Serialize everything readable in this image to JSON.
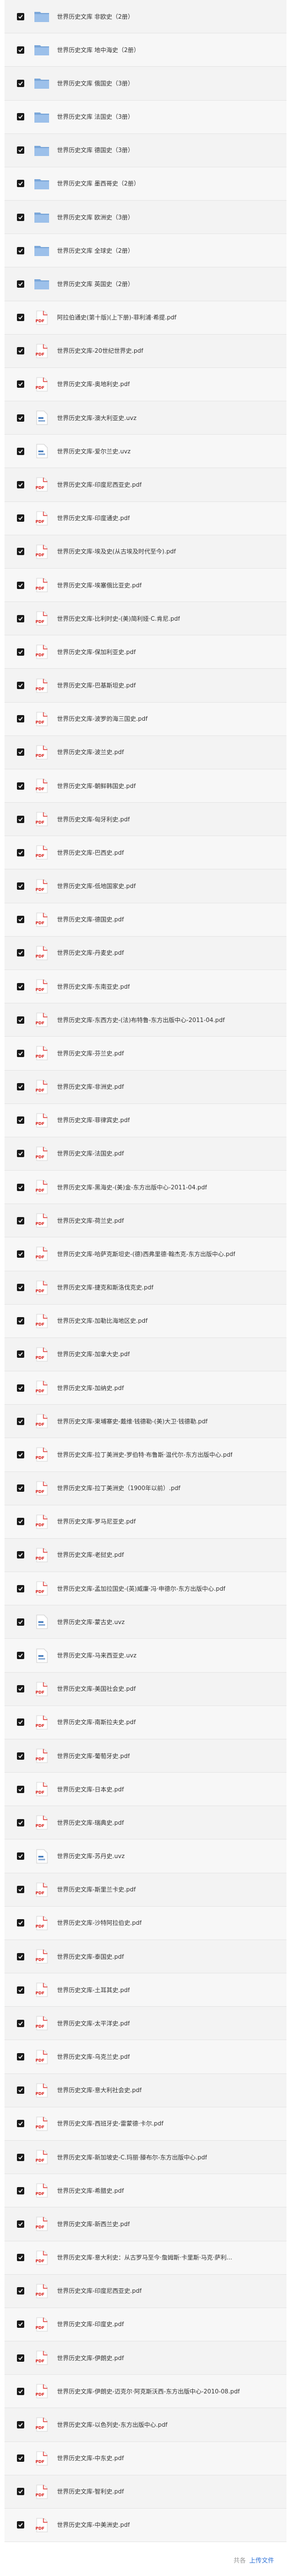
{
  "files": [
    {
      "name": "世界历史文库 非欧史（2册）",
      "icon": "folder-icon",
      "type": "folder"
    },
    {
      "name": "世界历史文库 地中海史（2册）",
      "icon": "folder-icon",
      "type": "folder"
    },
    {
      "name": "世界历史文库 俄国史（3册）",
      "icon": "folder-icon",
      "type": "folder"
    },
    {
      "name": "世界历史文库 法国史（3册）",
      "icon": "folder-icon",
      "type": "folder"
    },
    {
      "name": "世界历史文库 德国史（3册）",
      "icon": "folder-icon",
      "type": "folder"
    },
    {
      "name": "世界历史文库 墨西哥史（2册）",
      "icon": "folder-icon",
      "type": "folder"
    },
    {
      "name": "世界历史文库 欧洲史（3册）",
      "icon": "folder-icon",
      "type": "folder"
    },
    {
      "name": "世界历史文库 全球史（2册）",
      "icon": "folder-icon",
      "type": "folder"
    },
    {
      "name": "世界历史文库 英国史（2册）",
      "icon": "folder-icon",
      "type": "folder"
    },
    {
      "name": "阿拉伯通史(第十版)(上下册)-菲利浦·希提.pdf",
      "icon": "pdf-icon",
      "type": "pdf"
    },
    {
      "name": "世界历史文库-20世纪世界史.pdf",
      "icon": "pdf-icon",
      "type": "pdf"
    },
    {
      "name": "世界历史文库-奥地利史.pdf",
      "icon": "pdf-icon",
      "type": "pdf"
    },
    {
      "name": "世界历史文库-澳大利亚史.uvz",
      "icon": "uvz-icon",
      "type": "uvz"
    },
    {
      "name": "世界历史文库-爱尔兰史.uvz",
      "icon": "uvz-icon",
      "type": "uvz"
    },
    {
      "name": "世界历史文库-印度尼西亚史.pdf",
      "icon": "pdf-icon",
      "type": "pdf"
    },
    {
      "name": "世界历史文库-印度通史.pdf",
      "icon": "pdf-icon",
      "type": "pdf"
    },
    {
      "name": "世界历史文库-埃及史(从古埃及时代至今).pdf",
      "icon": "pdf-icon",
      "type": "pdf"
    },
    {
      "name": "世界历史文库-埃塞俄比亚史.pdf",
      "icon": "pdf-icon",
      "type": "pdf"
    },
    {
      "name": "世界历史文库-比利时史-(美)简利娅·C.肯尼.pdf",
      "icon": "pdf-icon",
      "type": "pdf"
    },
    {
      "name": "世界历史文库-保加利亚史.pdf",
      "icon": "pdf-icon",
      "type": "pdf"
    },
    {
      "name": "世界历史文库-巴基斯坦史.pdf",
      "icon": "pdf-icon",
      "type": "pdf"
    },
    {
      "name": "世界历史文库-波罗的海三国史.pdf",
      "icon": "pdf-icon",
      "type": "pdf"
    },
    {
      "name": "世界历史文库-波兰史.pdf",
      "icon": "pdf-icon",
      "type": "pdf"
    },
    {
      "name": "世界历史文库-朝鲜韩国史.pdf",
      "icon": "pdf-icon",
      "type": "pdf"
    },
    {
      "name": "世界历史文库-匈牙利史.pdf",
      "icon": "pdf-icon",
      "type": "pdf"
    },
    {
      "name": "世界历史文库-巴西史.pdf",
      "icon": "pdf-icon",
      "type": "pdf"
    },
    {
      "name": "世界历史文库-低地国家史.pdf",
      "icon": "pdf-icon",
      "type": "pdf"
    },
    {
      "name": "世界历史文库-德国史.pdf",
      "icon": "pdf-icon",
      "type": "pdf"
    },
    {
      "name": "世界历史文库-丹麦史.pdf",
      "icon": "pdf-icon",
      "type": "pdf"
    },
    {
      "name": "世界历史文库-东南亚史.pdf",
      "icon": "pdf-icon",
      "type": "pdf"
    },
    {
      "name": "世界历史文库-东西方史-(法)布特鲁-东方出版中心-2011-04.pdf",
      "icon": "pdf-icon",
      "type": "pdf"
    },
    {
      "name": "世界历史文库-芬兰史.pdf",
      "icon": "pdf-icon",
      "type": "pdf"
    },
    {
      "name": "世界历史文库-非洲史.pdf",
      "icon": "pdf-icon",
      "type": "pdf"
    },
    {
      "name": "世界历史文库-菲律宾史.pdf",
      "icon": "pdf-icon",
      "type": "pdf"
    },
    {
      "name": "世界历史文库-法国史.pdf",
      "icon": "pdf-icon",
      "type": "pdf"
    },
    {
      "name": "世界历史文库-黑海史-(美)金-东方出版中心-2011-04.pdf",
      "icon": "pdf-icon",
      "type": "pdf"
    },
    {
      "name": "世界历史文库-荷兰史.pdf",
      "icon": "pdf-icon",
      "type": "pdf"
    },
    {
      "name": "世界历史文库-哈萨克斯坦史-(德)西弗里德·翰杰克-东方出版中心.pdf",
      "icon": "pdf-icon",
      "type": "pdf"
    },
    {
      "name": "世界历史文库-捷克和斯洛伐克史.pdf",
      "icon": "pdf-icon",
      "type": "pdf"
    },
    {
      "name": "世界历史文库-加勒比海地区史.pdf",
      "icon": "pdf-icon",
      "type": "pdf"
    },
    {
      "name": "世界历史文库-加拿大史.pdf",
      "icon": "pdf-icon",
      "type": "pdf"
    },
    {
      "name": "世界历史文库-加纳史.pdf",
      "icon": "pdf-icon",
      "type": "pdf"
    },
    {
      "name": "世界历史文库-柬埔寨史-戴维·钱德勒-(美)大卫·钱德勒.pdf",
      "icon": "pdf-icon",
      "type": "pdf"
    },
    {
      "name": "世界历史文库-拉丁美洲史-罗伯特·布鲁斯·温代尔-东方出版中心.pdf",
      "icon": "pdf-icon",
      "type": "pdf"
    },
    {
      "name": "世界历史文库-拉丁美洲史（1900年以前）.pdf",
      "icon": "pdf-icon",
      "type": "pdf"
    },
    {
      "name": "世界历史文库-罗马尼亚史.pdf",
      "icon": "pdf-icon",
      "type": "pdf"
    },
    {
      "name": "世界历史文库-老挝史.pdf",
      "icon": "pdf-icon",
      "type": "pdf"
    },
    {
      "name": "世界历史文库-孟加拉国史-(英)威廉·冯·申德尔-东方出版中心.pdf",
      "icon": "pdf-icon",
      "type": "pdf"
    },
    {
      "name": "世界历史文库-蒙古史.uvz",
      "icon": "uvz-icon",
      "type": "uvz"
    },
    {
      "name": "世界历史文库-马来西亚史.uvz",
      "icon": "uvz-icon",
      "type": "uvz"
    },
    {
      "name": "世界历史文库-美国社会史.pdf",
      "icon": "pdf-icon",
      "type": "pdf"
    },
    {
      "name": "世界历史文库-南斯拉夫史.pdf",
      "icon": "pdf-icon",
      "type": "pdf"
    },
    {
      "name": "世界历史文库-葡萄牙史.pdf",
      "icon": "pdf-icon",
      "type": "pdf"
    },
    {
      "name": "世界历史文库-日本史.pdf",
      "icon": "pdf-icon",
      "type": "pdf"
    },
    {
      "name": "世界历史文库-瑞典史.pdf",
      "icon": "pdf-icon",
      "type": "pdf"
    },
    {
      "name": "世界历史文库-苏丹史.uvz",
      "icon": "uvz-icon",
      "type": "uvz"
    },
    {
      "name": "世界历史文库-斯里兰卡史.pdf",
      "icon": "pdf-icon",
      "type": "pdf"
    },
    {
      "name": "世界历史文库-沙特阿拉伯史.pdf",
      "icon": "pdf-icon",
      "type": "pdf"
    },
    {
      "name": "世界历史文库-泰国史.pdf",
      "icon": "pdf-icon",
      "type": "pdf"
    },
    {
      "name": "世界历史文库-土耳其史.pdf",
      "icon": "pdf-icon",
      "type": "pdf"
    },
    {
      "name": "世界历史文库-太平洋史.pdf",
      "icon": "pdf-icon",
      "type": "pdf"
    },
    {
      "name": "世界历史文库-乌克兰史.pdf",
      "icon": "pdf-icon",
      "type": "pdf"
    },
    {
      "name": "世界历史文库-意大利社会史.pdf",
      "icon": "pdf-icon",
      "type": "pdf"
    },
    {
      "name": "世界历史文库-西班牙史-雷蒙德·卡尔.pdf",
      "icon": "pdf-icon",
      "type": "pdf"
    },
    {
      "name": "世界历史文库-新加坡史-C.玛丽·滕布尔-东方出版中心.pdf",
      "icon": "pdf-icon",
      "type": "pdf"
    },
    {
      "name": "世界历史文库-希腊史.pdf",
      "icon": "pdf-icon",
      "type": "pdf"
    },
    {
      "name": "世界历史文库-新西兰史.pdf",
      "icon": "pdf-icon",
      "type": "pdf"
    },
    {
      "name": "世界历史文库-意大利史：从古罗马至今·詹姆斯·卡里斯·马克·萨利...",
      "icon": "pdf-icon",
      "type": "pdf"
    },
    {
      "name": "世界历史文库-印度尼西亚史.pdf",
      "icon": "pdf-icon",
      "type": "pdf"
    },
    {
      "name": "世界历史文库-印度史.pdf",
      "icon": "pdf-icon",
      "type": "pdf"
    },
    {
      "name": "世界历史文库-伊朗史.pdf",
      "icon": "pdf-icon",
      "type": "pdf"
    },
    {
      "name": "世界历史文库-伊朗史-迈克尔·阿克斯沃西-东方出版中心-2010-08.pdf",
      "icon": "pdf-icon",
      "type": "pdf"
    },
    {
      "name": "世界历史文库-以色列史-东方出版中心.pdf",
      "icon": "pdf-icon",
      "type": "pdf"
    },
    {
      "name": "世界历史文库-中东史.pdf",
      "icon": "pdf-icon",
      "type": "pdf"
    },
    {
      "name": "世界历史文库-智利史.pdf",
      "icon": "pdf-icon",
      "type": "pdf"
    },
    {
      "name": "世界历史文库-中美洲史.pdf",
      "icon": "pdf-icon",
      "type": "pdf"
    }
  ],
  "footer": {
    "count_text": "共各",
    "upload_label": "上传文件"
  },
  "colors": {
    "folder": "#7ba7d9",
    "folder_tab": "#9cc0ea",
    "pdf": "#d9231e",
    "uvz": "#4a7fbf",
    "link": "#2b6fd6"
  }
}
